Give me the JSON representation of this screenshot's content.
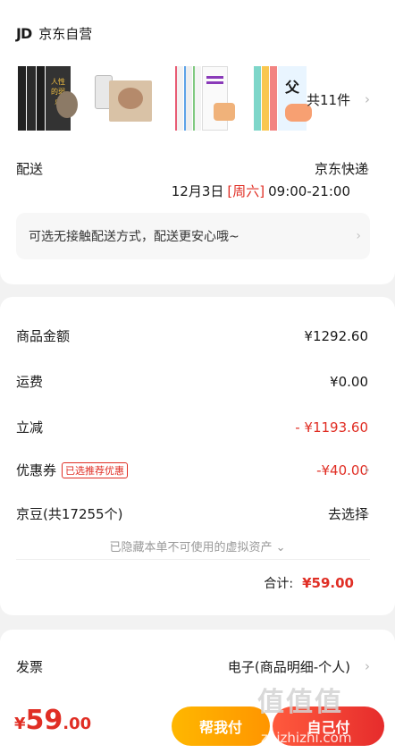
{
  "shop": {
    "logo": "JD",
    "name": "京东自营",
    "product_count": "共11件",
    "products": [
      "book-set-1",
      "book-2",
      "book-set-3",
      "book-set-4"
    ],
    "book1_title": "人性的弱点"
  },
  "delivery": {
    "label": "配送",
    "carrier": "京东快递",
    "date": "12月3日",
    "weekday": "[周六]",
    "time": "09:00-21:00",
    "tip": "可选无接触配送方式，配送更安心哦~"
  },
  "price": {
    "goods_label": "商品金额",
    "goods_value": "¥1292.60",
    "shipping_label": "运费",
    "shipping_value": "¥0.00",
    "discount_label": "立减",
    "discount_value": "- ¥1193.60",
    "coupon_label": "优惠券",
    "coupon_tag": "已选推荐优惠",
    "coupon_value": "-¥40.00",
    "bean_label": "京豆(共17255个)",
    "bean_action": "去选择",
    "hidden_note": "已隐藏本单不可使用的虚拟资产 ⌄",
    "total_label": "合计:",
    "total_value": "¥59.00"
  },
  "invoice": {
    "label": "发票",
    "value": "电子(商品明细-个人)"
  },
  "bottom": {
    "currency": "¥",
    "int": "59",
    "dec": ".00",
    "help_btn": "帮我付",
    "pay_btn": "自己付"
  },
  "watermark": {
    "text": "值值值",
    "url": "zhizhizhi.com"
  },
  "colors": {
    "accent_red": "#e02e24",
    "orange": "#ff9500"
  }
}
